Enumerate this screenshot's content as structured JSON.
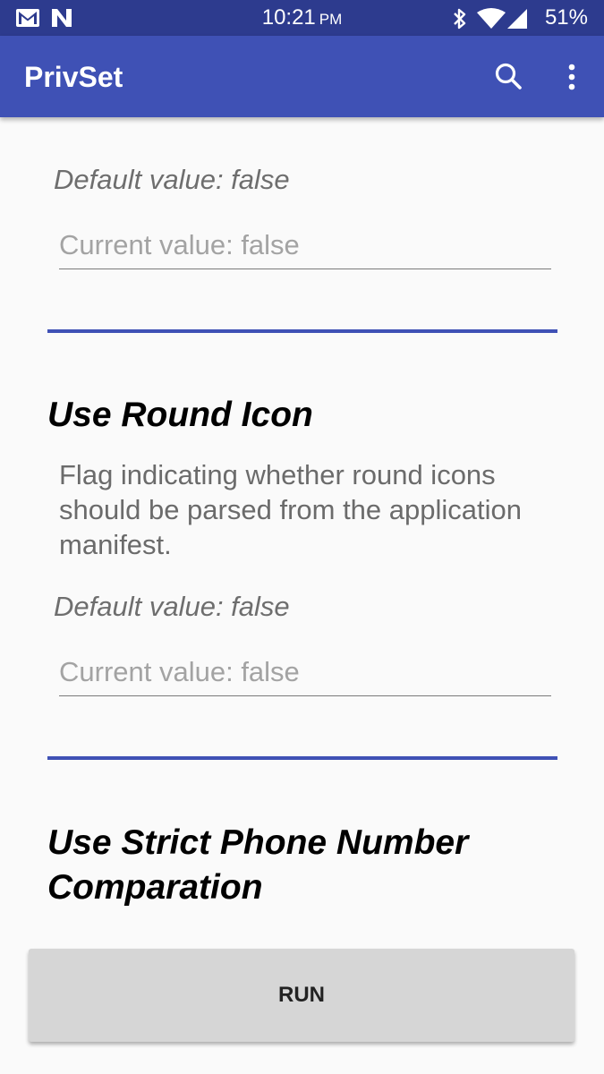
{
  "status_bar": {
    "time": "10:21",
    "ampm": "PM",
    "battery_percent": "51%",
    "left_icons": [
      "gmail-icon",
      "n-notification-icon"
    ],
    "right_icons": [
      "bluetooth-icon",
      "wifi-icon",
      "cell-signal-icon",
      "battery-icon"
    ]
  },
  "app_bar": {
    "title": "PrivSet",
    "actions": [
      "search-icon",
      "more-vert-icon"
    ],
    "color": "#3f51b5"
  },
  "settings": [
    {
      "default_value": "Default value: false",
      "current_value_placeholder": "Current value: false"
    },
    {
      "title": "Use Round Icon",
      "description": "Flag indicating whether round icons should be parsed from the application manifest.",
      "default_value": "Default value: false",
      "current_value_placeholder": "Current value: false"
    },
    {
      "title": "Use Strict Phone Number Comparation"
    }
  ],
  "run_button": {
    "label": "RUN"
  },
  "colors": {
    "primary": "#3f51b5",
    "primary_dark": "#2d3b8e",
    "background": "#fafafa",
    "button": "#d6d6d6"
  }
}
